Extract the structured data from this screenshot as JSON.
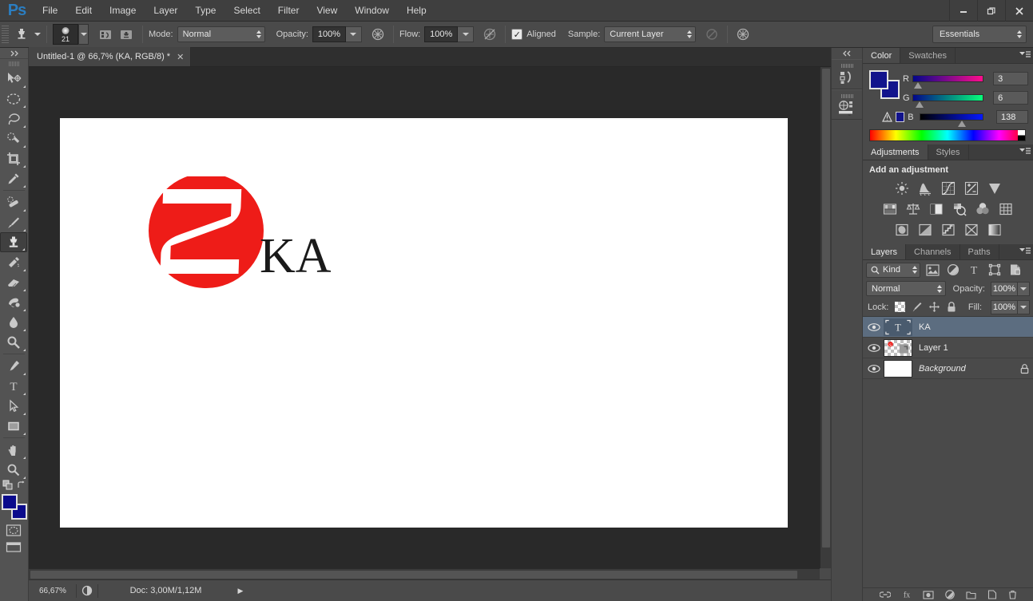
{
  "app": {
    "name": "Ps",
    "title": "Adobe Photoshop"
  },
  "menubar": {
    "items": [
      "File",
      "Edit",
      "Image",
      "Layer",
      "Type",
      "Select",
      "Filter",
      "View",
      "Window",
      "Help"
    ]
  },
  "window_controls": {
    "minimize": "–",
    "restore": "❐",
    "close": "✕"
  },
  "options_bar": {
    "tool": "clone-stamp-tool",
    "brush_size": "21",
    "mode_label": "Mode:",
    "mode_value": "Normal",
    "opacity_label": "Opacity:",
    "opacity_value": "100%",
    "flow_label": "Flow:",
    "flow_value": "100%",
    "aligned_label": "Aligned",
    "aligned_checked": "✓",
    "sample_label": "Sample:",
    "sample_value": "Current Layer",
    "workspace": "Essentials"
  },
  "toolbar": {
    "tools": [
      {
        "name": "move-tool",
        "selected": false
      },
      {
        "name": "elliptical-marquee-tool",
        "selected": false
      },
      {
        "name": "lasso-tool",
        "selected": false
      },
      {
        "name": "quick-selection-tool",
        "selected": false
      },
      {
        "name": "crop-tool",
        "selected": false
      },
      {
        "name": "eyedropper-tool",
        "selected": false
      },
      {
        "name": "spot-healing-brush-tool",
        "selected": false
      },
      {
        "name": "brush-tool",
        "selected": false
      },
      {
        "name": "clone-stamp-tool",
        "selected": true
      },
      {
        "name": "history-brush-tool",
        "selected": false
      },
      {
        "name": "eraser-tool",
        "selected": false
      },
      {
        "name": "gradient-tool",
        "selected": false
      },
      {
        "name": "blur-tool",
        "selected": false
      },
      {
        "name": "dodge-tool",
        "selected": false
      },
      {
        "name": "pen-tool",
        "selected": false
      },
      {
        "name": "horizontal-type-tool",
        "selected": false
      },
      {
        "name": "path-selection-tool",
        "selected": false
      },
      {
        "name": "rectangle-tool",
        "selected": false
      },
      {
        "name": "hand-tool",
        "selected": false
      },
      {
        "name": "zoom-tool",
        "selected": false
      }
    ],
    "foreground_color": "#0a0a8c",
    "background_color": "#0a0a8c"
  },
  "document": {
    "tab_title": "Untitled-1 @ 66,7% (KA, RGB/8) *",
    "close_glyph": "✕",
    "artwork": {
      "circle_color": "#ee1c18",
      "letter": "S",
      "text": "KA",
      "text_color": "#1a1a1a"
    }
  },
  "status_bar": {
    "zoom": "66,67%",
    "doc_info": "Doc: 3,00M/1,12M",
    "arrow": "▶"
  },
  "icon_dock": {
    "collapse_glyph": "◂◂",
    "items": [
      {
        "name": "history-panel-icon"
      },
      {
        "name": "mini-bridge-panel-icon"
      }
    ]
  },
  "color_panel": {
    "tabs": [
      {
        "label": "Color",
        "active": true
      },
      {
        "label": "Swatches",
        "active": false
      }
    ],
    "foreground_color": "#12138c",
    "background_color": "#12138c",
    "sliders": [
      {
        "label": "R",
        "value": "3",
        "pos": 3
      },
      {
        "label": "G",
        "value": "6",
        "pos": 6
      },
      {
        "label": "B",
        "value": "138",
        "pos": 54
      }
    ],
    "out_of_gamut_warning": "⚠"
  },
  "adjustments_panel": {
    "tabs": [
      {
        "label": "Adjustments",
        "active": true
      },
      {
        "label": "Styles",
        "active": false
      }
    ],
    "heading": "Add an adjustment",
    "icons": [
      "brightness-contrast-icon",
      "levels-icon",
      "curves-icon",
      "exposure-icon",
      "vibrance-icon",
      "hue-saturation-icon",
      "color-balance-icon",
      "black-white-icon",
      "photo-filter-icon",
      "channel-mixer-icon",
      "color-lookup-icon",
      "invert-icon",
      "posterize-icon",
      "threshold-icon",
      "selective-color-icon",
      "gradient-map-icon"
    ]
  },
  "layers_panel": {
    "tabs": [
      {
        "label": "Layers",
        "active": true
      },
      {
        "label": "Channels",
        "active": false
      },
      {
        "label": "Paths",
        "active": false
      }
    ],
    "filter": {
      "kind_label": "Kind",
      "search_icon": "search-icon",
      "type_filters": [
        "pixel-layer-filter-icon",
        "adjustment-layer-filter-icon",
        "type-layer-filter-icon",
        "shape-layer-filter-icon",
        "smart-object-filter-icon"
      ]
    },
    "blend_mode": "Normal",
    "opacity_label": "Opacity:",
    "opacity_value": "100%",
    "lock_label": "Lock:",
    "lock_icons": [
      "lock-transparent-pixels-icon",
      "lock-image-pixels-icon",
      "lock-position-icon",
      "lock-all-icon"
    ],
    "fill_label": "Fill:",
    "fill_value": "100%",
    "layers": [
      {
        "name": "KA",
        "type": "type",
        "visible": true,
        "selected": true,
        "locked": false,
        "italic": false
      },
      {
        "name": "Layer 1",
        "type": "pixel",
        "visible": true,
        "selected": false,
        "locked": false,
        "italic": false
      },
      {
        "name": "Background",
        "type": "background",
        "visible": true,
        "selected": false,
        "locked": true,
        "italic": true
      }
    ],
    "footer_icons": [
      "link-layers-icon",
      "layer-style-icon",
      "layer-mask-icon",
      "new-fill-adjustment-icon",
      "new-group-icon",
      "new-layer-icon",
      "delete-layer-icon"
    ]
  }
}
